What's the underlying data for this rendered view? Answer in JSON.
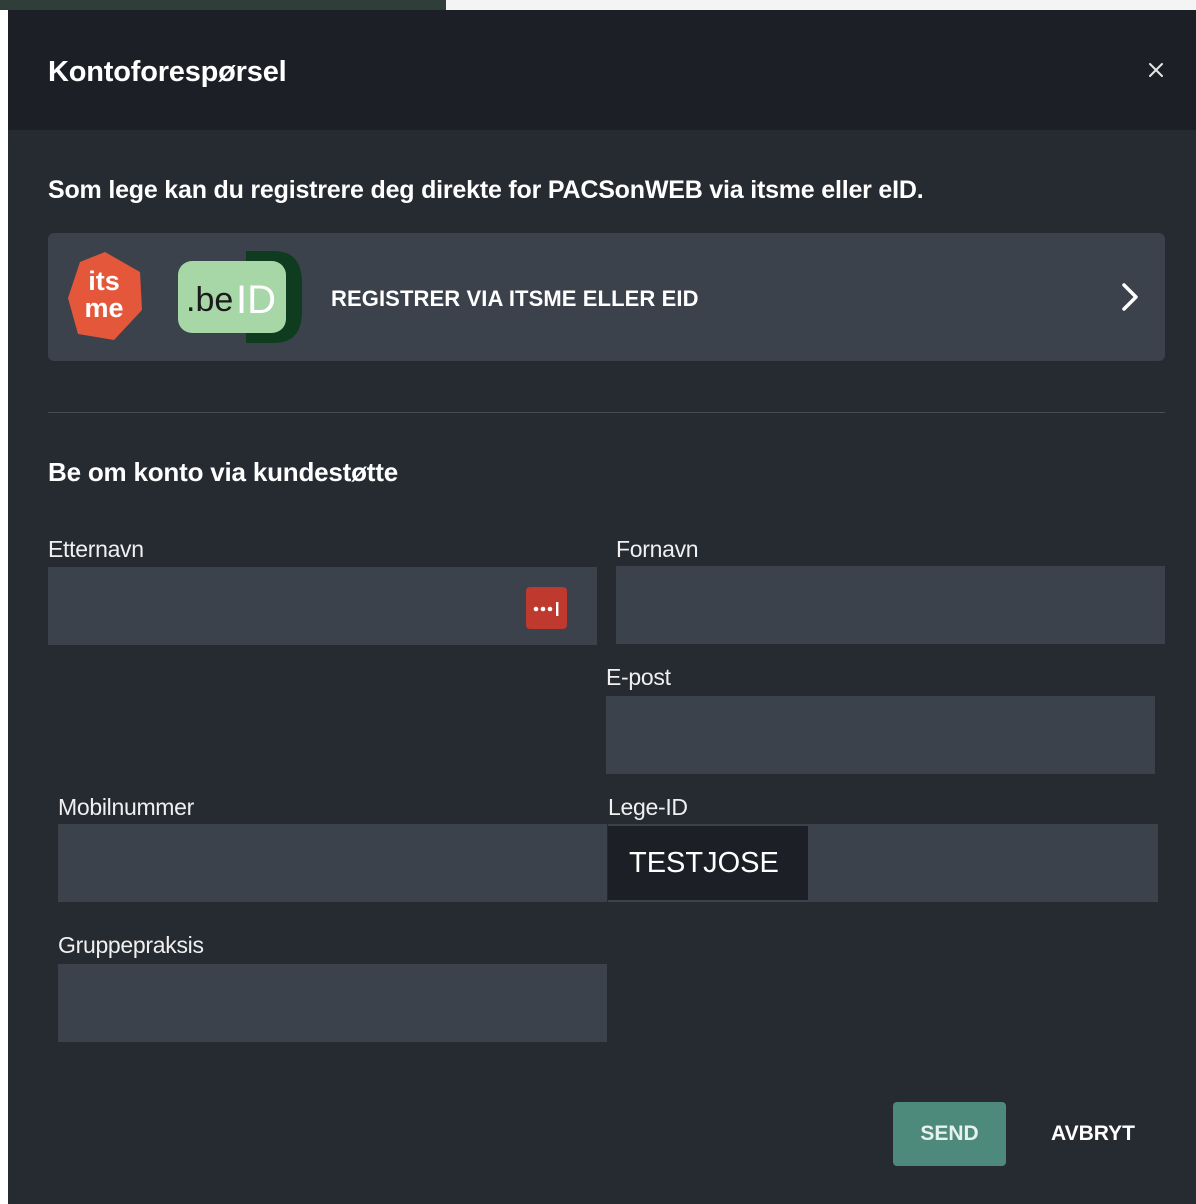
{
  "dialog": {
    "title": "Kontoforespørsel",
    "close_icon": "close-icon"
  },
  "intro": {
    "text": "Som lege kan du registrere deg direkte for PACSonWEB via itsme eller eID."
  },
  "register": {
    "label": "REGISTRER VIA ITSME ELLER EID",
    "itsme_logo_top": "its",
    "itsme_logo_bottom": "me",
    "beid_logo_prefix": ".be",
    "beid_logo_suffix": "ID",
    "chevron_icon": "chevron-right-icon"
  },
  "form": {
    "heading": "Be om konto via kundestøtte",
    "fields": {
      "etternavn": {
        "label": "Etternavn",
        "value": "",
        "icon": "password-manager-icon"
      },
      "fornavn": {
        "label": "Fornavn",
        "value": ""
      },
      "epost": {
        "label": "E-post",
        "value": ""
      },
      "mobilnummer": {
        "label": "Mobilnummer",
        "value": ""
      },
      "lege_id": {
        "label": "Lege-ID",
        "value": "TESTJOSE"
      },
      "gruppepraksis": {
        "label": "Gruppepraksis",
        "value": ""
      }
    }
  },
  "actions": {
    "send_label": "SEND",
    "cancel_label": "AVBRYT"
  },
  "colors": {
    "dialog_bg": "#262a31",
    "header_bg": "#1c1f25",
    "input_bg": "#3c424b",
    "accent": "#4e8a7b",
    "itsme": "#e5573b",
    "beid": "#a7d6a7"
  }
}
